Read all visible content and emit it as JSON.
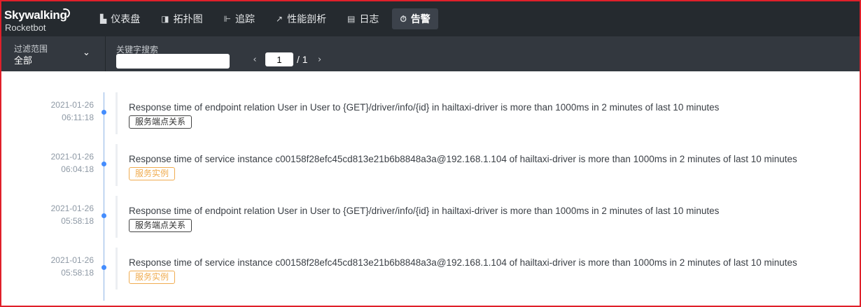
{
  "app": {
    "brand": "Skywalking",
    "sub": "Rocketbot"
  },
  "nav": [
    {
      "label": "仪表盘",
      "icon": "dashboard-icon",
      "glyph": "▙",
      "active": false
    },
    {
      "label": "拓扑图",
      "icon": "topology-icon",
      "glyph": "◨",
      "active": false
    },
    {
      "label": "追踪",
      "icon": "trace-icon",
      "glyph": "⊩",
      "active": false
    },
    {
      "label": "性能剖析",
      "icon": "profile-icon",
      "glyph": "↗",
      "active": false
    },
    {
      "label": "日志",
      "icon": "log-icon",
      "glyph": "▤",
      "active": false
    },
    {
      "label": "告警",
      "icon": "alarm-icon",
      "glyph": "⏱",
      "active": true
    }
  ],
  "filter": {
    "scope_label": "过滤范围",
    "scope_value": "全部",
    "keyword_label": "关键字搜索",
    "keyword_value": "",
    "page_current": "1",
    "page_total": "/ 1",
    "prev_glyph": "‹",
    "next_glyph": "›",
    "dropdown_glyph": "⌄"
  },
  "alarms": [
    {
      "date": "2021-01-26",
      "time": "06:11:18",
      "message": "Response time of endpoint relation User in User to {GET}/driver/info/{id} in hailtaxi-driver is more than 1000ms in 2 minutes of last 10 minutes",
      "tag": "服务端点关系",
      "tag_type": "endpoint-relation"
    },
    {
      "date": "2021-01-26",
      "time": "06:04:18",
      "message": "Response time of service instance c00158f28efc45cd813e21b6b8848a3a@192.168.1.104 of hailtaxi-driver is more than 1000ms in 2 minutes of last 10 minutes",
      "tag": "服务实例",
      "tag_type": "instance"
    },
    {
      "date": "2021-01-26",
      "time": "05:58:18",
      "message": "Response time of endpoint relation User in User to {GET}/driver/info/{id} in hailtaxi-driver is more than 1000ms in 2 minutes of last 10 minutes",
      "tag": "服务端点关系",
      "tag_type": "endpoint-relation"
    },
    {
      "date": "2021-01-26",
      "time": "05:58:18",
      "message": "Response time of service instance c00158f28efc45cd813e21b6b8848a3a@192.168.1.104 of hailtaxi-driver is more than 1000ms in 2 minutes of last 10 minutes",
      "tag": "服务实例",
      "tag_type": "instance"
    }
  ],
  "colors": {
    "nav_bg": "#252a2f",
    "filter_bg": "#33383f",
    "timeline_dot": "#448dfe",
    "instance_tag": "#f0ac50",
    "frame_border": "#e0202a"
  }
}
